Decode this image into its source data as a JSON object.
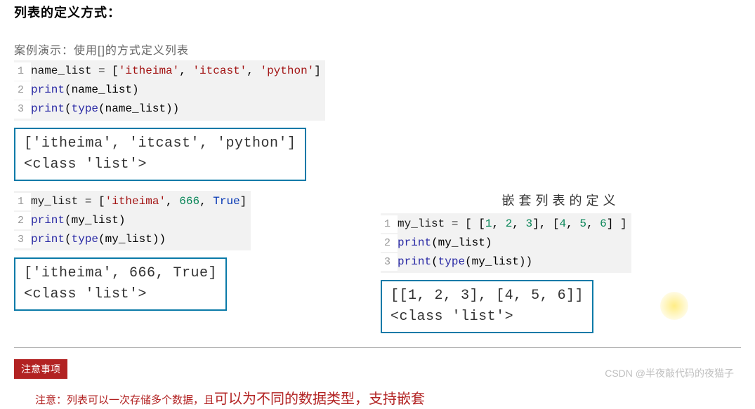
{
  "title": "列表的定义方式：",
  "section1": {
    "label": "案例演示：使用[]的方式定义列表",
    "code": {
      "lines": [
        {
          "n": "1",
          "parts": [
            {
              "t": "name_list ",
              "c": "tok-var"
            },
            {
              "t": "=",
              "c": "tok-op"
            },
            {
              "t": " [",
              "c": "tok-br"
            },
            {
              "t": "'itheima'",
              "c": "tok-str"
            },
            {
              "t": ", ",
              "c": "tok-br"
            },
            {
              "t": "'itcast'",
              "c": "tok-str"
            },
            {
              "t": ", ",
              "c": "tok-br"
            },
            {
              "t": "'python'",
              "c": "tok-str"
            },
            {
              "t": "]",
              "c": "tok-br"
            }
          ]
        },
        {
          "n": "2",
          "parts": [
            {
              "t": "print",
              "c": "tok-fn"
            },
            {
              "t": "(name_list)",
              "c": "tok-br"
            }
          ]
        },
        {
          "n": "3",
          "parts": [
            {
              "t": "print",
              "c": "tok-fn"
            },
            {
              "t": "(",
              "c": "tok-br"
            },
            {
              "t": "type",
              "c": "tok-fn"
            },
            {
              "t": "(name_list))",
              "c": "tok-br"
            }
          ]
        }
      ]
    },
    "output": "['itheima', 'itcast', 'python']\n<class 'list'>"
  },
  "section2": {
    "code": {
      "lines": [
        {
          "n": "1",
          "parts": [
            {
              "t": "my_list ",
              "c": "tok-var"
            },
            {
              "t": "=",
              "c": "tok-op"
            },
            {
              "t": " [",
              "c": "tok-br"
            },
            {
              "t": "'itheima'",
              "c": "tok-str"
            },
            {
              "t": ", ",
              "c": "tok-br"
            },
            {
              "t": "666",
              "c": "tok-num"
            },
            {
              "t": ", ",
              "c": "tok-br"
            },
            {
              "t": "True",
              "c": "tok-bool"
            },
            {
              "t": "]",
              "c": "tok-br"
            }
          ]
        },
        {
          "n": "2",
          "parts": [
            {
              "t": "print",
              "c": "tok-fn"
            },
            {
              "t": "(my_list)",
              "c": "tok-br"
            }
          ]
        },
        {
          "n": "3",
          "parts": [
            {
              "t": "print",
              "c": "tok-fn"
            },
            {
              "t": "(",
              "c": "tok-br"
            },
            {
              "t": "type",
              "c": "tok-fn"
            },
            {
              "t": "(my_list))",
              "c": "tok-br"
            }
          ]
        }
      ]
    },
    "output": "['itheima', 666, True]\n<class 'list'>"
  },
  "section3": {
    "heading": "嵌套列表的定义",
    "code": {
      "lines": [
        {
          "n": "1",
          "parts": [
            {
              "t": "my_list ",
              "c": "tok-var"
            },
            {
              "t": "=",
              "c": "tok-op"
            },
            {
              "t": " [ [",
              "c": "tok-br"
            },
            {
              "t": "1",
              "c": "tok-num"
            },
            {
              "t": ", ",
              "c": "tok-br"
            },
            {
              "t": "2",
              "c": "tok-num"
            },
            {
              "t": ", ",
              "c": "tok-br"
            },
            {
              "t": "3",
              "c": "tok-num"
            },
            {
              "t": "], [",
              "c": "tok-br"
            },
            {
              "t": "4",
              "c": "tok-num"
            },
            {
              "t": ", ",
              "c": "tok-br"
            },
            {
              "t": "5",
              "c": "tok-num"
            },
            {
              "t": ", ",
              "c": "tok-br"
            },
            {
              "t": "6",
              "c": "tok-num"
            },
            {
              "t": "] ]",
              "c": "tok-br"
            }
          ]
        },
        {
          "n": "2",
          "parts": [
            {
              "t": "print",
              "c": "tok-fn"
            },
            {
              "t": "(my_list)",
              "c": "tok-br"
            }
          ]
        },
        {
          "n": "3",
          "parts": [
            {
              "t": "print",
              "c": "tok-fn"
            },
            {
              "t": "(",
              "c": "tok-br"
            },
            {
              "t": "type",
              "c": "tok-fn"
            },
            {
              "t": "(my_list))",
              "c": "tok-br"
            }
          ]
        }
      ]
    },
    "output": "[[1, 2, 3], [4, 5, 6]]\n<class 'list'>"
  },
  "notice": {
    "tag": "注意事项",
    "prefix": "注意：列表可以一次存储多个数据，且",
    "emphasis": "可以为不同的数据类型，支持嵌套"
  },
  "watermark": "CSDN @半夜敲代码的夜猫子"
}
